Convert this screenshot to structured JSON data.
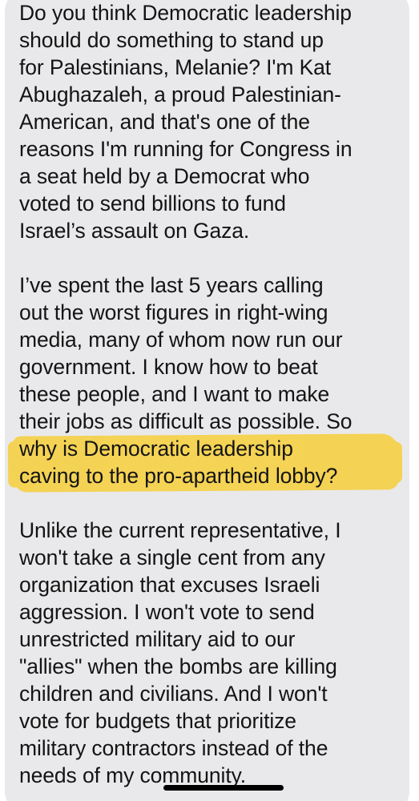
{
  "message": {
    "paragraphs": [
      {
        "lines": [
          "Do you think Democratic leadership",
          "should do something to stand up",
          "for Palestinians, Melanie? I'm Kat",
          "Abughazaleh, a proud Palestinian-",
          "American, and that's one of the",
          "reasons I'm running for Congress in",
          "a seat held by a Democrat who",
          "voted to send billions to fund",
          "Israel’s assault on Gaza."
        ]
      },
      {
        "lines": [
          "I’ve spent the last 5 years calling",
          "out the worst figures in right-wing",
          "media, many of whom now run our",
          "government. I know how to beat",
          "these people, and I want to make",
          "their jobs as difficult as possible. So",
          "why is Democratic leadership",
          "caving to the pro-apartheid lobby?"
        ]
      },
      {
        "lines": [
          "Unlike the current representative, I",
          "won't take a single cent from any",
          "organization that excuses Israeli",
          "aggression. I won't vote to send",
          "unrestricted military aid to our",
          "\"allies\" when the bombs are killing",
          "children and civilians. And I won't",
          "vote for budgets that prioritize",
          "military contractors instead of the",
          "needs of my community."
        ]
      }
    ]
  },
  "colors": {
    "bubble": "#e9e9eb",
    "text": "#141414",
    "highlight": "#f7cf3a"
  }
}
